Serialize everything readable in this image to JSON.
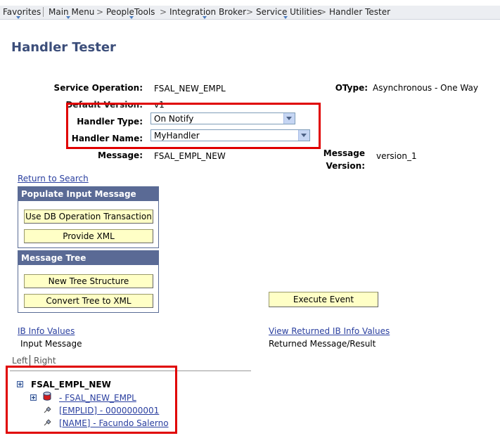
{
  "nav": {
    "items": [
      "Favorites",
      "Main Menu",
      "PeopleTools",
      "Integration Broker",
      "Service Utilities",
      "Handler Tester"
    ],
    "separator": ">"
  },
  "page_title": "Handler Tester",
  "form": {
    "service_operation_label": "Service Operation:",
    "service_operation_value": "FSAL_NEW_EMPL",
    "otype_label": "OType:",
    "otype_value": "Asynchronous - One Way",
    "default_version_label": "Default Version:",
    "default_version_value": "v1",
    "handler_type_label": "Handler Type:",
    "handler_type_value": "On Notify",
    "handler_name_label": "Handler Name:",
    "handler_name_value": "MyHandler",
    "message_label": "Message:",
    "message_value": "FSAL_EMPL_NEW",
    "message_version_label_1": "Message",
    "message_version_label_2": "Version:",
    "message_version_value": "version_1"
  },
  "return_to_search": "Return to Search",
  "populate_panel": {
    "title": "Populate Input Message",
    "btn_db": "Use DB Operation Transaction",
    "btn_xml": "Provide XML"
  },
  "tree_panel": {
    "title": "Message Tree",
    "btn_new": "New Tree Structure",
    "btn_convert": "Convert Tree to XML"
  },
  "execute_event": "Execute Event",
  "ib_info_values": "IB Info Values",
  "input_message": "Input Message",
  "view_returned": "View Returned IB Info Values",
  "returned_message": "Returned Message/Result",
  "tabs": {
    "left": "Left",
    "right": "Right"
  },
  "tree": {
    "root": "FSAL_EMPL_NEW",
    "record": "- FSAL_NEW_EMPL",
    "field1": "[EMPLID] - 0000000001",
    "field2": "[NAME] - Facundo Salerno"
  },
  "colors": {
    "highlight": "#e00000",
    "link": "#2b40a0",
    "panel_header": "#5a6a95",
    "button": "#ffffc6"
  }
}
